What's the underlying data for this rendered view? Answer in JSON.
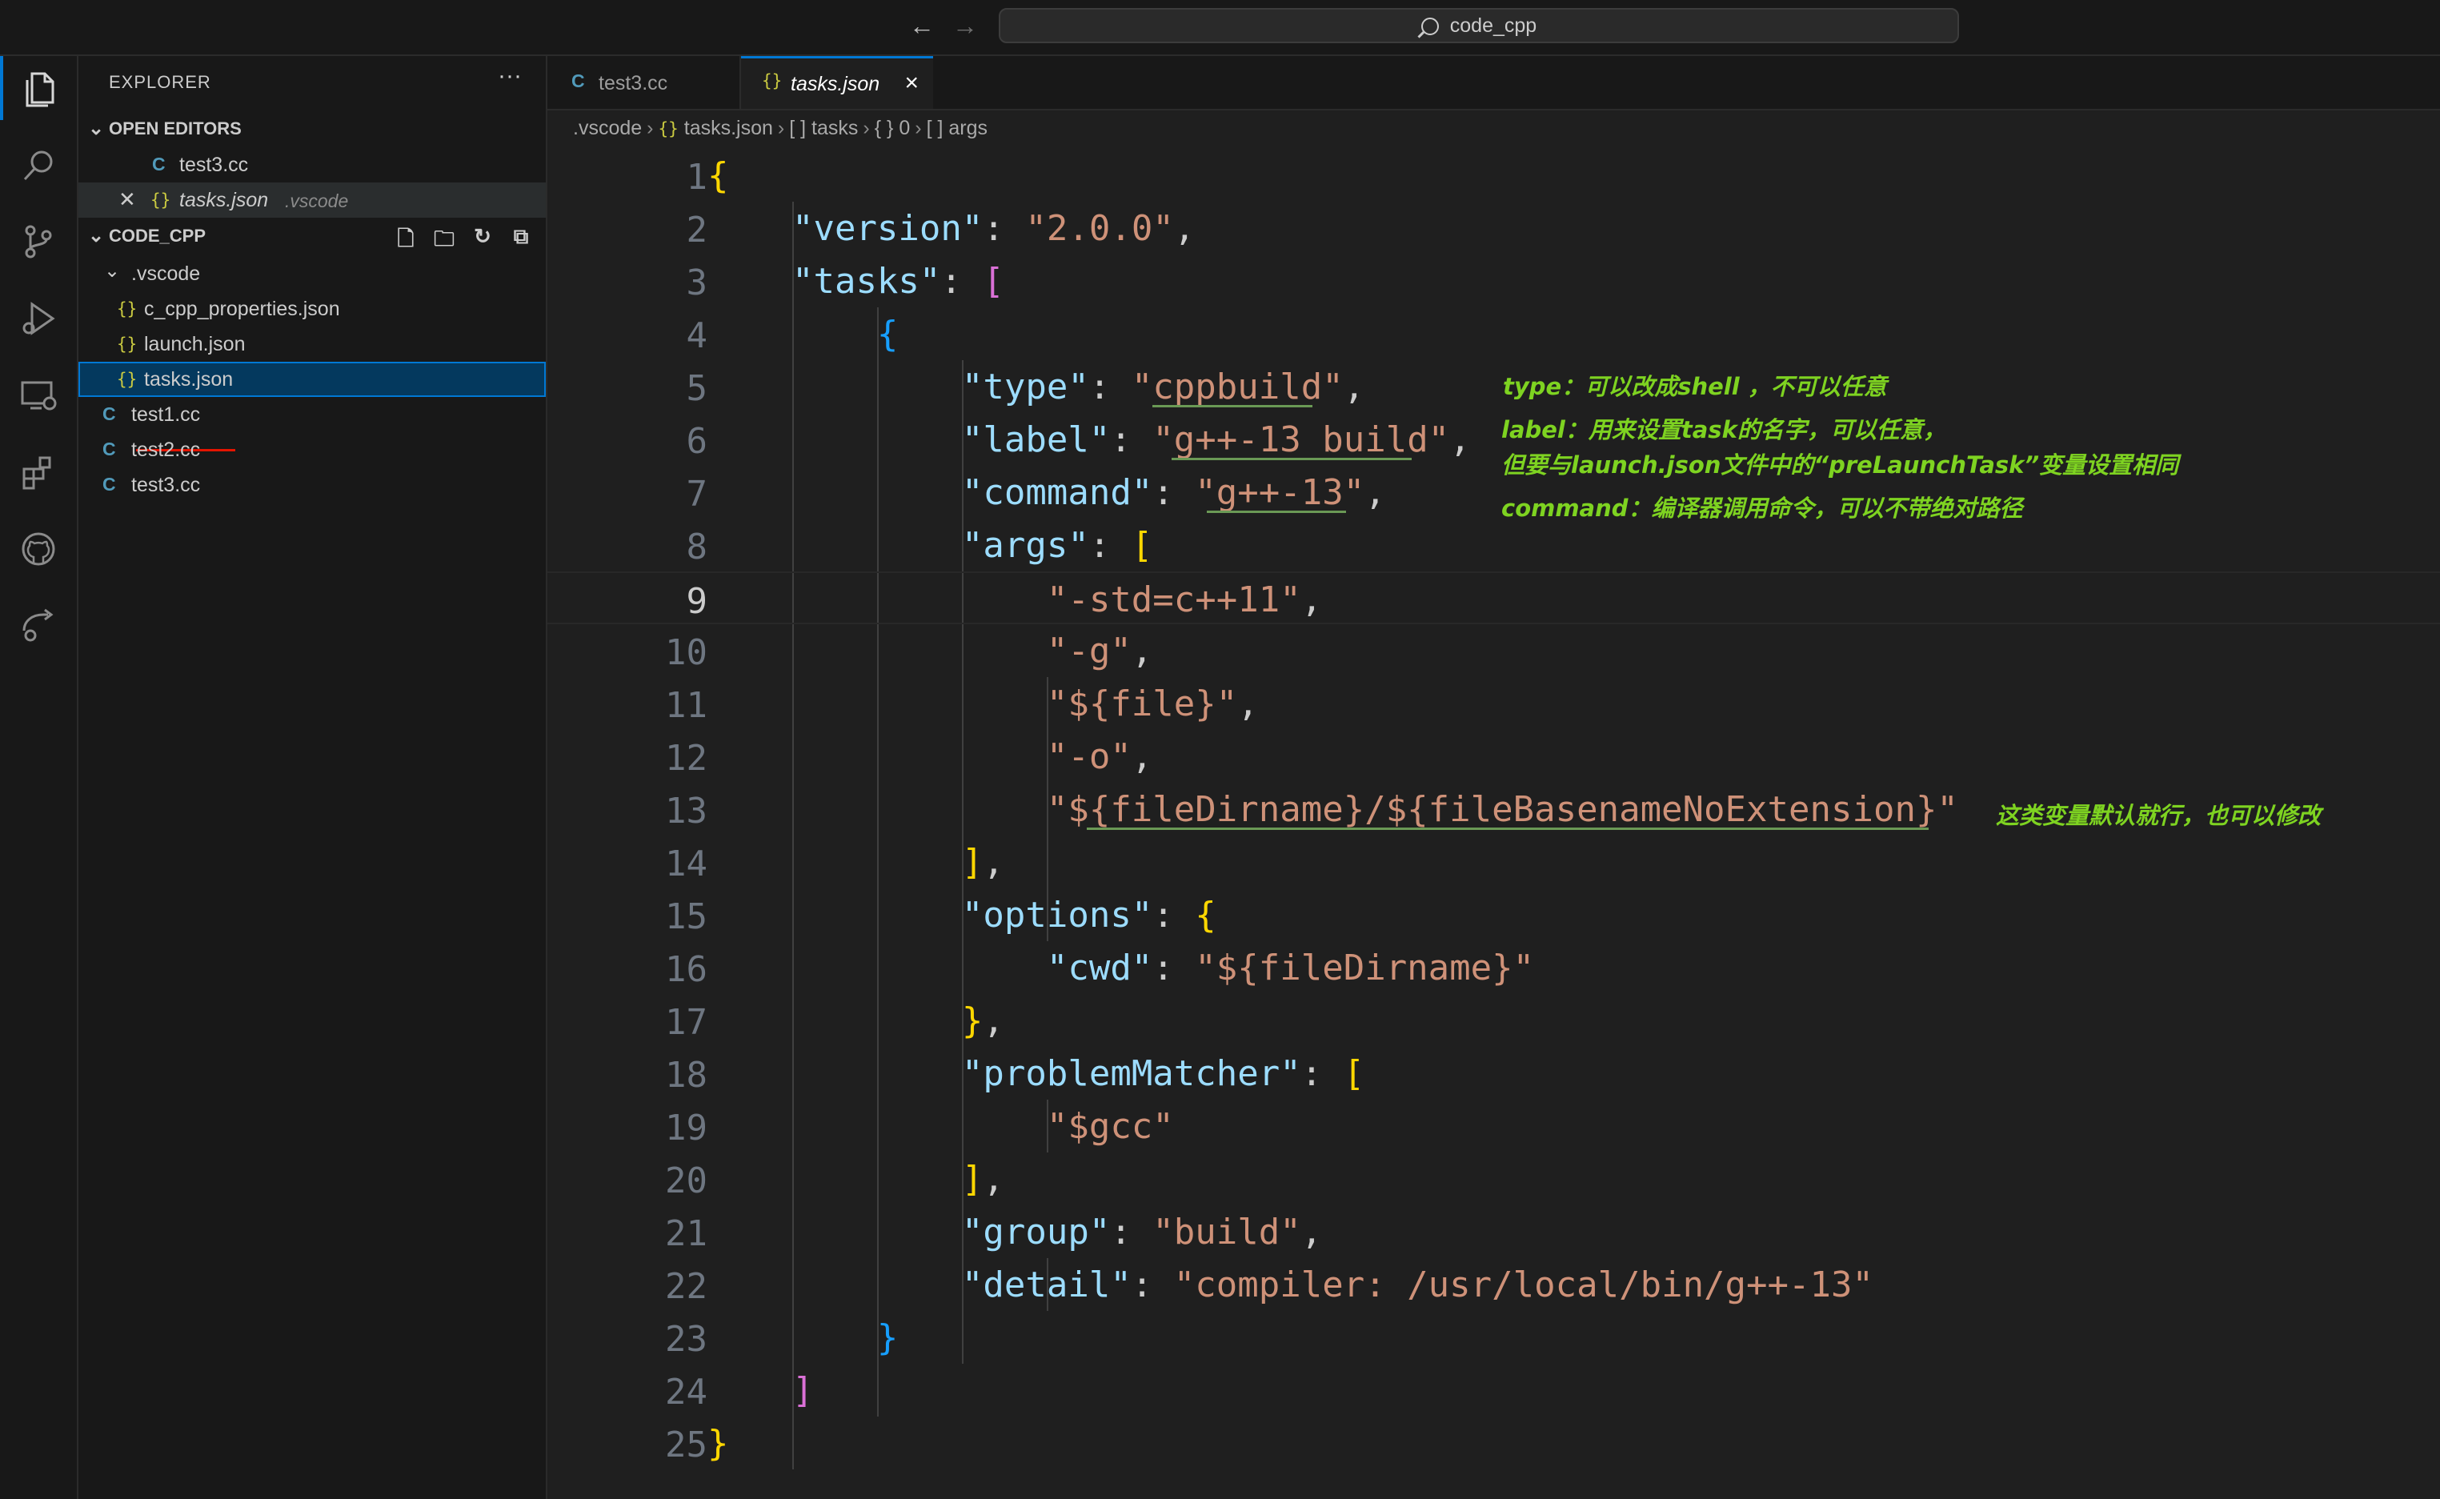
{
  "titlebar": {
    "search_text": "code_cpp",
    "back_icon": "arrow-left-icon",
    "forward_icon": "arrow-right-icon"
  },
  "activity": [
    "explorer-icon",
    "search-icon",
    "source-control-icon",
    "run-debug-icon",
    "remote-explorer-icon",
    "extensions-icon",
    "github-icon",
    "live-share-icon"
  ],
  "sidebar": {
    "title": "EXPLORER",
    "more": "···",
    "open_editors": {
      "header": "OPEN EDITORS",
      "items": [
        {
          "name": "test3.cc"
        },
        {
          "name": "tasks.json",
          "hint": ".vscode"
        }
      ]
    },
    "workspace": {
      "header": "CODE_CPP",
      "folder": ".vscode",
      "folder_files": [
        "c_cpp_properties.json",
        "launch.json",
        "tasks.json"
      ],
      "files": [
        "test1.cc",
        "test2.cc",
        "test3.cc"
      ]
    }
  },
  "tabs": [
    {
      "label": "test3.cc",
      "active": false
    },
    {
      "label": "tasks.json",
      "active": true
    }
  ],
  "breadcrumb": {
    "folder": ".vscode",
    "file": "tasks.json",
    "b1": "tasks",
    "b2": "0",
    "b3": "args"
  },
  "editor": {
    "current_line": 9,
    "lines": [
      {
        "n": "1"
      },
      {
        "n": "2"
      },
      {
        "n": "3"
      },
      {
        "n": "4"
      },
      {
        "n": "5"
      },
      {
        "n": "6"
      },
      {
        "n": "7"
      },
      {
        "n": "8"
      },
      {
        "n": "9"
      },
      {
        "n": "10"
      },
      {
        "n": "11"
      },
      {
        "n": "12"
      },
      {
        "n": "13"
      },
      {
        "n": "14"
      },
      {
        "n": "15"
      },
      {
        "n": "16"
      },
      {
        "n": "17"
      },
      {
        "n": "18"
      },
      {
        "n": "19"
      },
      {
        "n": "20"
      },
      {
        "n": "21"
      },
      {
        "n": "22"
      },
      {
        "n": "23"
      },
      {
        "n": "24"
      },
      {
        "n": "25"
      }
    ],
    "code": {
      "version_key": "\"version\"",
      "version_val": "\"2.0.0\"",
      "tasks_key": "\"tasks\"",
      "type_key": "\"type\"",
      "type_val": "\"cppbuild\"",
      "label_key": "\"label\"",
      "label_val": "\"g++-13 build\"",
      "command_key": "\"command\"",
      "command_val": "\"g++-13\"",
      "args_key": "\"args\"",
      "arg1": "\"-std=c++11\"",
      "arg2": "\"-g\"",
      "arg3": "\"${file}\"",
      "arg4": "\"-o\"",
      "arg5": "\"${fileDirname}/${fileBasenameNoExtension}\"",
      "options_key": "\"options\"",
      "cwd_key": "\"cwd\"",
      "cwd_val": "\"${fileDirname}\"",
      "pm_key": "\"problemMatcher\"",
      "pm_val": "\"$gcc\"",
      "group_key": "\"group\"",
      "group_val": "\"build\"",
      "detail_key": "\"detail\"",
      "detail_val": "\"compiler: /usr/local/bin/g++-13\""
    }
  },
  "annotations": {
    "type": "type：可以改成shell ，不可以任意",
    "label_1": "label：用来设置task的名字，可以任意，",
    "label_2": "但要与launch.json文件中的“preLaunchTask”变量设置相同",
    "command": "command：编译器调用命令，可以不带绝对路径",
    "args": "这类变量默认就行，也可以修改"
  }
}
